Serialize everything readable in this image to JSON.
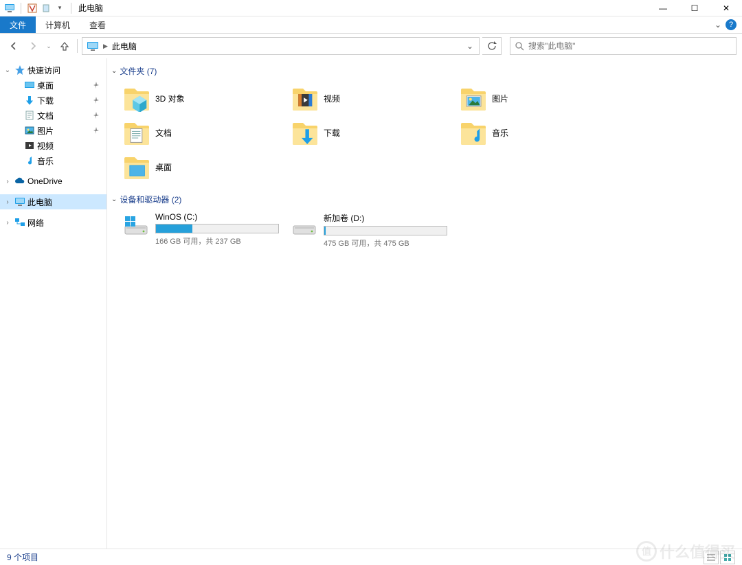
{
  "window": {
    "title": "此电脑",
    "minimize_glyph": "—",
    "maximize_glyph": "☐",
    "close_glyph": "✕"
  },
  "ribbon": {
    "file": "文件",
    "computer": "计算机",
    "view": "查看",
    "help_glyph": "?"
  },
  "nav": {
    "address_crumb": "此电脑",
    "search_placeholder": "搜索\"此电脑\""
  },
  "sidebar": {
    "quick_access": "快速访问",
    "quick_items": [
      {
        "label": "桌面",
        "icon": "desktop"
      },
      {
        "label": "下载",
        "icon": "download"
      },
      {
        "label": "文档",
        "icon": "document"
      },
      {
        "label": "图片",
        "icon": "picture"
      },
      {
        "label": "视频",
        "icon": "video"
      },
      {
        "label": "音乐",
        "icon": "music"
      }
    ],
    "onedrive": "OneDrive",
    "this_pc": "此电脑",
    "network": "网络"
  },
  "groups": {
    "folders_header": "文件夹 (7)",
    "folders": [
      {
        "label": "3D 对象",
        "icon": "3d"
      },
      {
        "label": "视频",
        "icon": "video"
      },
      {
        "label": "图片",
        "icon": "picture"
      },
      {
        "label": "文档",
        "icon": "document"
      },
      {
        "label": "下载",
        "icon": "download"
      },
      {
        "label": "音乐",
        "icon": "music"
      },
      {
        "label": "桌面",
        "icon": "desktop"
      }
    ],
    "drives_header": "设备和驱动器 (2)",
    "drives": [
      {
        "name": "WinOS (C:)",
        "sub": "166 GB 可用，共 237 GB",
        "fill_pct": 30,
        "os": true
      },
      {
        "name": "新加卷 (D:)",
        "sub": "475 GB 可用，共 475 GB",
        "fill_pct": 1,
        "os": false
      }
    ]
  },
  "statusbar": {
    "text": "9 个项目"
  },
  "watermark": "什么值得买"
}
